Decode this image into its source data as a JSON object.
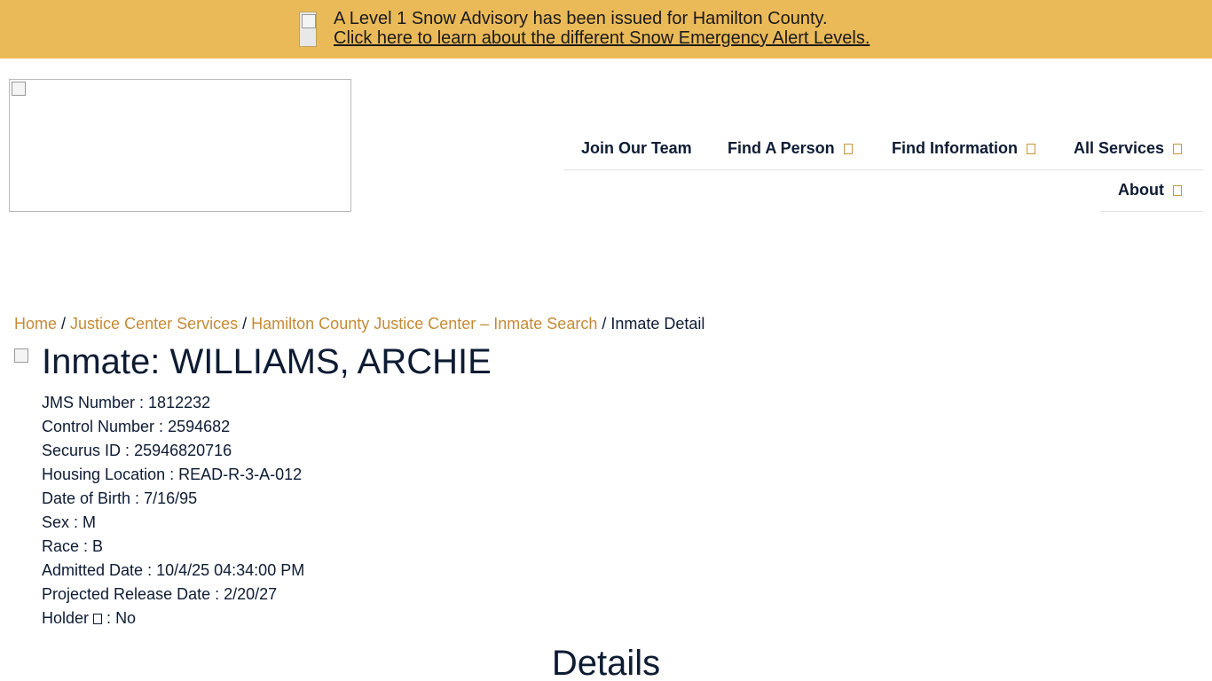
{
  "alert": {
    "message": "A Level 1 Snow Advisory has been issued for Hamilton County.",
    "link_text": "Click here to learn about the different Snow Emergency Alert Levels.",
    "icon": "snowflake-icon"
  },
  "header": {
    "logo_icon": "broken-image-icon"
  },
  "nav": {
    "items": [
      {
        "label": "Join Our Team",
        "has_dropdown": false
      },
      {
        "label": "Find A Person",
        "has_dropdown": true
      },
      {
        "label": "Find Information",
        "has_dropdown": true
      },
      {
        "label": "All Services",
        "has_dropdown": true
      },
      {
        "label": "About",
        "has_dropdown": true
      }
    ],
    "dropdown_icon": "chevron-down-icon"
  },
  "breadcrumb": {
    "items": [
      {
        "label": "Home",
        "link": true
      },
      {
        "label": "Justice Center Services",
        "link": true
      },
      {
        "label": "Hamilton County Justice Center – Inmate Search",
        "link": true
      },
      {
        "label": "Inmate Detail",
        "link": false
      }
    ],
    "separator": "/"
  },
  "inmate": {
    "title": "Inmate: WILLIAMS, ARCHIE",
    "fields": [
      {
        "label": "JMS Number",
        "value": "1812232"
      },
      {
        "label": "Control Number",
        "value": "2594682"
      },
      {
        "label": "Securus ID",
        "value": "25946820716"
      },
      {
        "label": "Housing Location",
        "value": "READ-R-3-A-012"
      },
      {
        "label": "Date of Birth",
        "value": "7/16/95"
      },
      {
        "label": "Sex",
        "value": "M"
      },
      {
        "label": "Race",
        "value": "B"
      },
      {
        "label": "Admitted Date",
        "value": "10/4/25 04:34:00 PM"
      },
      {
        "label": "Projected Release Date",
        "value": "2/20/27"
      },
      {
        "label": "Holder",
        "value": "No"
      }
    ],
    "separator": " : "
  },
  "details": {
    "heading": "Details"
  },
  "colors": {
    "alert_bg": "#ebba58",
    "link": "#c48b36",
    "text": "#0d1b33"
  }
}
